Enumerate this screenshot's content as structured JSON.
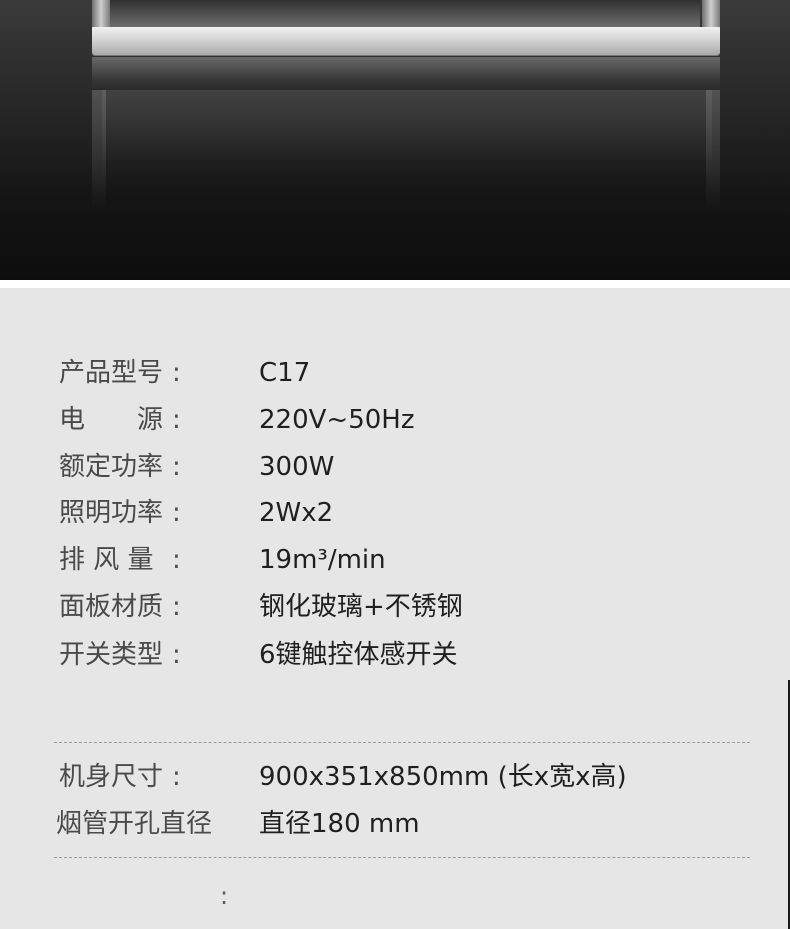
{
  "specs": [
    {
      "label": "产品型号",
      "colon": ":",
      "value": "C17"
    },
    {
      "label": "电　　源",
      "colon": ":",
      "value": "220V~50Hz"
    },
    {
      "label": "额定功率",
      "colon": ":",
      "value": "300W"
    },
    {
      "label": "照明功率",
      "colon": ":",
      "value": "2Wx2"
    },
    {
      "label": "排 风 量",
      "colon": ":",
      "value": "19m³/min"
    },
    {
      "label": "面板材质",
      "colon": ":",
      "value": "钢化玻璃+不锈钢"
    },
    {
      "label": "开关类型",
      "colon": ":",
      "value": "6键触控体感开关"
    }
  ],
  "dimensions": [
    {
      "label": "机身尺寸",
      "colon": ":",
      "value": "900x351x850mm (长x宽x高)"
    },
    {
      "label": "烟管开孔直径",
      "value": "直径180 mm"
    }
  ],
  "trailing_colon": ":"
}
